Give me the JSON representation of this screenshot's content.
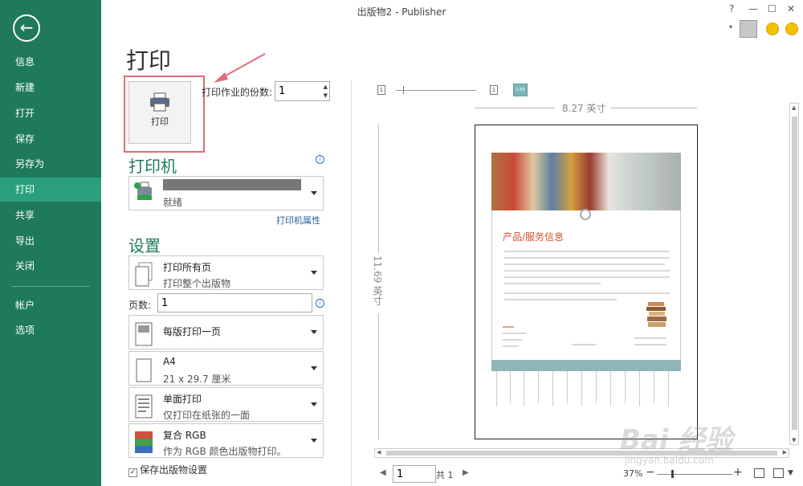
{
  "window": {
    "title": "出版物2 - Publisher",
    "help": "?",
    "min": "—",
    "max": "☐",
    "close": "✕",
    "avatar_caret": "▾"
  },
  "nav": {
    "back_icon": "←",
    "items": [
      {
        "label": "信息"
      },
      {
        "label": "新建"
      },
      {
        "label": "打开"
      },
      {
        "label": "保存"
      },
      {
        "label": "另存为"
      },
      {
        "label": "打印",
        "active": true
      },
      {
        "label": "共享"
      },
      {
        "label": "导出"
      },
      {
        "label": "关闭"
      },
      {
        "label": "帐户"
      },
      {
        "label": "选项"
      }
    ]
  },
  "print": {
    "title": "打印",
    "button_label": "打印",
    "copies_label": "打印作业的份数:",
    "copies_value": "1"
  },
  "printer": {
    "section": "打印机",
    "status": "就绪",
    "properties_link": "打印机属性",
    "info_icon": "i"
  },
  "settings": {
    "section": "设置",
    "pages_dd": {
      "main": "打印所有页",
      "sub": "打印整个出版物"
    },
    "pages_label": "页数:",
    "pages_value": "1",
    "info_icon": "i",
    "per_sheet_dd": {
      "main": "每版打印一页"
    },
    "paper_dd": {
      "main": "A4",
      "sub": "21 x 29.7 厘米"
    },
    "sides_dd": {
      "main": "单面打印",
      "sub": "仅打印在纸张的一面"
    },
    "color_dd": {
      "main": "复合 RGB",
      "sub": "作为 RGB 颜色出版物打印。"
    },
    "save_settings": "保存出版物设置"
  },
  "preview": {
    "page_icon_1": "1",
    "page_icon_2": "1",
    "page_icon_3": "1-85",
    "width_label": "8.27 英寸",
    "height_label": "11.69 英寸",
    "doc_heading": "产品/服务信息"
  },
  "statusbar": {
    "prev": "◀",
    "page_value": "1",
    "page_total": "共 1",
    "next": "▶",
    "zoom": "37%",
    "zoom_minus": "−",
    "zoom_plus": "+",
    "view_caret": "▼"
  },
  "watermark": {
    "main": "Bai 经验",
    "sub": "jingyan.baidu.com"
  },
  "colors": {
    "nav_bg": "#1f7a5c",
    "nav_active": "#29a07b",
    "accent": "#1f7a5c",
    "highlight": "#e46c7a"
  }
}
